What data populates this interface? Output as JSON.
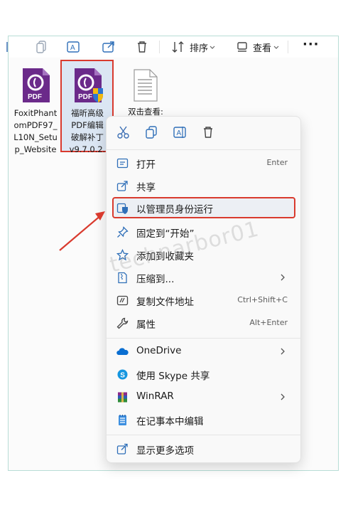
{
  "toolbar": {
    "sort_label": "排序",
    "view_label": "查看"
  },
  "files": [
    {
      "name_lines": [
        "FoxitPhant",
        "omPDF97_",
        "L10N_Setu",
        "p_Website"
      ],
      "icon": "foxit-pdf-icon"
    },
    {
      "name_lines": [
        "福昕高级",
        "PDF编辑",
        "破解补丁",
        "v9.7.0.2."
      ],
      "icon": "foxit-pdf-shield-icon",
      "selected": true
    },
    {
      "name_lines": [
        "双击查看:"
      ],
      "icon": "text-document-icon"
    }
  ],
  "context_menu": {
    "items": [
      {
        "label": "打开",
        "shortcut": "Enter",
        "icon": "open-icon"
      },
      {
        "label": "共享",
        "icon": "share-icon"
      },
      {
        "label": "以管理员身份运行",
        "icon": "admin-shield-icon",
        "highlighted": true
      },
      {
        "label": "固定到“开始”",
        "icon": "pin-icon"
      },
      {
        "label": "添加到收藏夹",
        "icon": "star-icon"
      },
      {
        "label": "压缩到...",
        "icon": "zip-icon",
        "submenu": true
      },
      {
        "label": "复制文件地址",
        "shortcut": "Ctrl+Shift+C",
        "icon": "copy-path-icon"
      },
      {
        "label": "属性",
        "shortcut": "Alt+Enter",
        "icon": "wrench-icon"
      },
      {
        "label": "OneDrive",
        "icon": "onedrive-icon",
        "submenu": true
      },
      {
        "label": "使用 Skype 共享",
        "icon": "skype-icon"
      },
      {
        "label": "WinRAR",
        "icon": "winrar-icon",
        "submenu": true
      },
      {
        "label": "在记事本中编辑",
        "icon": "notepad-icon"
      },
      {
        "label": "显示更多选项",
        "icon": "more-options-icon"
      }
    ]
  },
  "watermark": "technarbor01",
  "colors": {
    "highlight_border": "#d93a2e",
    "accent": "#0067c0",
    "foxit_purple": "#6b2a8a"
  }
}
